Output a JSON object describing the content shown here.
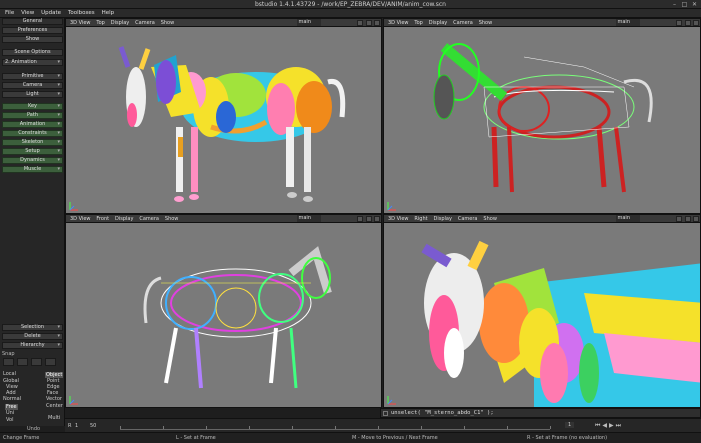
{
  "window": {
    "title": "bstudio 1.4.1.43729 - /work/EP_ZEBRA/DEV/ANIM/anim_cow.scn"
  },
  "menu": [
    "File",
    "View",
    "Update",
    "Toolboxes",
    "Help"
  ],
  "left_panel": {
    "header_tab": "General",
    "buttons_top": [
      "Preferences",
      "Show",
      "Scene Options"
    ],
    "animation_dropdown": "2. Animation",
    "animation_items": [
      "Primitive",
      "Camera",
      "Light"
    ],
    "green_items": [
      "Key",
      "Path",
      "Animation",
      "Constraints",
      "Skeleton",
      "Setup",
      "Dynamics",
      "Muscle"
    ],
    "bottom_buttons": [
      "Selection",
      "Delete",
      "Hierarchy"
    ],
    "snap_label": "Snap",
    "transform_modes": [
      "Local",
      "Global",
      "View",
      "Add",
      "Normal",
      "Free",
      "Uni",
      "Vol"
    ],
    "selected_transform": "Free",
    "selection_modes": [
      "Object",
      "Point",
      "Edge",
      "Face",
      "Vector",
      "Center",
      "Multi"
    ],
    "selected_selection": "Object",
    "undo_label": "Undo"
  },
  "viewports": [
    {
      "name": "3D View",
      "menus": [
        "Top",
        "Display",
        "Camera",
        "Show"
      ],
      "camera": "main"
    },
    {
      "name": "3D View",
      "menus": [
        "Top",
        "Display",
        "Camera",
        "Show"
      ],
      "camera": "main"
    },
    {
      "name": "3D View",
      "menus": [
        "Front",
        "Display",
        "Camera",
        "Show"
      ],
      "camera": "main"
    },
    {
      "name": "3D View",
      "menus": [
        "Right",
        "Display",
        "Camera",
        "Show"
      ],
      "camera": "main"
    }
  ],
  "command_line": "unselect( \"M_sterno_abdo_C1\" );",
  "timeline": {
    "start": "1",
    "end": "50",
    "current": "1",
    "ticks": [
      "0",
      "5",
      "10",
      "15",
      "20",
      "25",
      "30",
      "35",
      "40",
      "45",
      "50"
    ]
  },
  "status": {
    "left": "Change Frame",
    "l_hint": "L - Set at Frame",
    "m_hint": "M - Move to Previous / Next Frame",
    "r_hint": "R - Set at Frame (no evaluation)"
  }
}
